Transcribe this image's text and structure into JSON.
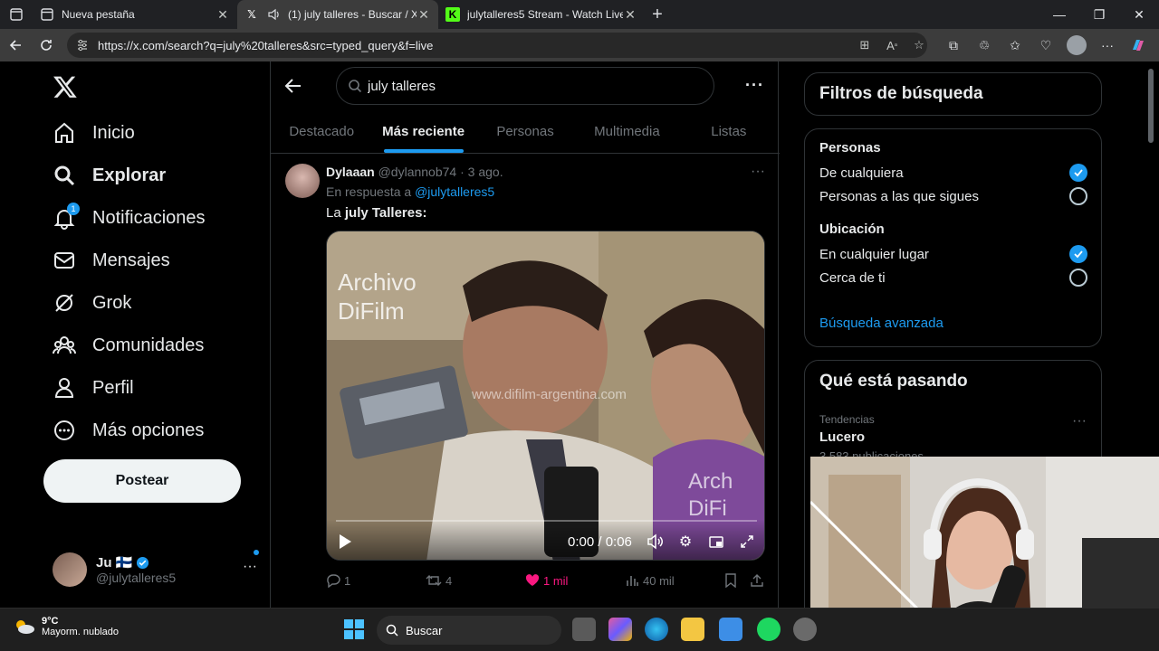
{
  "browser": {
    "tabs": [
      {
        "title": "Nueva pestaña",
        "favicon": "page-icon"
      },
      {
        "title": "(1) july talleres - Buscar / X",
        "favicon": "x-logo-icon"
      },
      {
        "title": "julytalleres5 Stream - Watch Live",
        "favicon": "kick-logo-icon"
      }
    ],
    "active_tab": 1,
    "url": "https://x.com/search?q=july%20talleres&src=typed_query&f=live"
  },
  "nav": {
    "items": [
      {
        "label": "Inicio",
        "icon": "home-icon"
      },
      {
        "label": "Explorar",
        "icon": "search-icon"
      },
      {
        "label": "Notificaciones",
        "icon": "bell-icon",
        "badge": "1"
      },
      {
        "label": "Mensajes",
        "icon": "mail-icon"
      },
      {
        "label": "Grok",
        "icon": "grok-icon"
      },
      {
        "label": "Comunidades",
        "icon": "communities-icon"
      },
      {
        "label": "Perfil",
        "icon": "person-icon"
      },
      {
        "label": "Más opciones",
        "icon": "more-circle-icon"
      }
    ],
    "post_label": "Postear",
    "account": {
      "name": "Ju",
      "flag": "🇫🇮",
      "handle": "@julytalleres5"
    }
  },
  "search": {
    "query": "july talleres",
    "tabs": [
      "Destacado",
      "Más reciente",
      "Personas",
      "Multimedia",
      "Listas"
    ],
    "active_tab": "Más reciente"
  },
  "tweet": {
    "author": "Dylaaan",
    "handle": "@dylannob74",
    "time": "· 3 ago.",
    "reply_prefix": "En respuesta a ",
    "reply_to": "@julytalleres5",
    "text_prefix": "La ",
    "text_bold": "july Talleres:",
    "video": {
      "watermark_top": "Archivo DiFilm",
      "watermark_mid": "www.difilm-argentina.com",
      "watermark_bottom": "Arch DiFi",
      "time": "0:00 / 0:06"
    },
    "replies": "1",
    "reposts": "4",
    "likes": "1 mil",
    "views": "40 mil"
  },
  "filters": {
    "title": "Filtros de búsqueda",
    "people_heading": "Personas",
    "people_options": [
      {
        "label": "De cualquiera",
        "checked": true
      },
      {
        "label": "Personas a las que sigues",
        "checked": false
      }
    ],
    "location_heading": "Ubicación",
    "location_options": [
      {
        "label": "En cualquier lugar",
        "checked": true
      },
      {
        "label": "Cerca de ti",
        "checked": false
      }
    ],
    "advanced": "Búsqueda avanzada"
  },
  "trends": {
    "title": "Qué está pasando",
    "items": [
      {
        "category": "Tendencias",
        "name": "Lucero",
        "count": "3.583 publicaciones"
      }
    ]
  },
  "taskbar": {
    "temp": "9°C",
    "weather": "Mayorm. nublado",
    "search_label": "Buscar"
  },
  "colors": {
    "accent": "#1d9bf0",
    "like": "#f91880",
    "background": "#000000"
  }
}
